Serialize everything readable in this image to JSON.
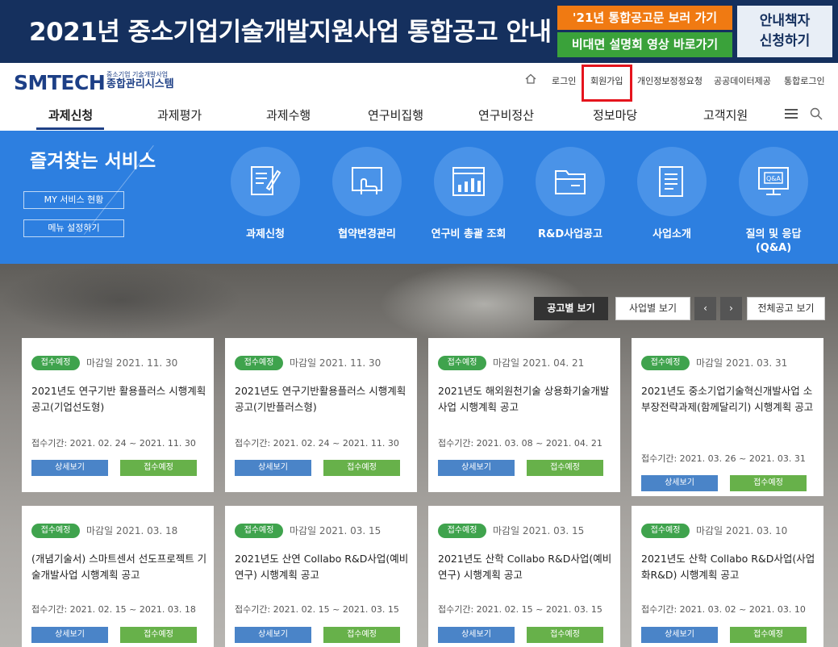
{
  "banner": {
    "title": "2021년 중소기업기술개발지원사업 통합공고 안내",
    "button_notice": "'21년 통합공고문 보러 가기",
    "button_video": "비대면 설명회 영상 바로가기",
    "button_guide_line1": "안내책자",
    "button_guide_line2": "신청하기"
  },
  "header": {
    "logo": "SMTECH",
    "logo_sub1": "중소기업 기술개발사업",
    "logo_sub2": "종합관리시스템",
    "util_links": [
      "로그인",
      "회원가입",
      "개인정보정정요청",
      "공공데이터제공",
      "통합로그인"
    ]
  },
  "gnb": {
    "items": [
      "과제신청",
      "과제평가",
      "과제수행",
      "연구비집행",
      "연구비정산",
      "정보마당",
      "고객지원"
    ]
  },
  "quick": {
    "title": "즐겨찾는 서비스",
    "my_service": "MY 서비스 현황",
    "menu_setting": "메뉴 설정하기",
    "services": [
      {
        "label": "과제신청",
        "icon": "document-edit-icon"
      },
      {
        "label": "협약변경관리",
        "icon": "hand-touch-icon"
      },
      {
        "label": "연구비 총괄 조회",
        "icon": "bar-chart-icon"
      },
      {
        "label": "R&D사업공고",
        "icon": "folder-icon"
      },
      {
        "label": "사업소개",
        "icon": "document-list-icon"
      },
      {
        "label": "질의 및 응답\n(Q&A)",
        "icon": "qa-monitor-icon"
      }
    ]
  },
  "notices": {
    "tab_by_notice": "공고별 보기",
    "tab_by_business": "사업별 보기",
    "prev": "‹",
    "next": "›",
    "view_all": "전체공고 보기",
    "cards": [
      {
        "badge": "접수예정",
        "deadline": "마감일 2021. 11. 30",
        "title": "2021년도 연구기반 활용플러스 시행계획 공고(기업선도형)",
        "period": "접수기간: 2021. 02. 24 ~ 2021. 11. 30",
        "detail": "상세보기",
        "status": "접수예정"
      },
      {
        "badge": "접수예정",
        "deadline": "마감일 2021. 11. 30",
        "title": "2021년도 연구기반활용플러스 시행계획 공고(기반플러스형)",
        "period": "접수기간: 2021. 02. 24 ~ 2021. 11. 30",
        "detail": "상세보기",
        "status": "접수예정"
      },
      {
        "badge": "접수예정",
        "deadline": "마감일 2021. 04. 21",
        "title": "2021년도 해외원천기술 상용화기술개발사업 시행계획 공고",
        "period": "접수기간: 2021. 03. 08 ~ 2021. 04. 21",
        "detail": "상세보기",
        "status": "접수예정"
      },
      {
        "badge": "접수예정",
        "deadline": "마감일 2021. 03. 31",
        "title": "2021년도 중소기업기술혁신개발사업 소부장전략과제(함께달리기) 시행계획 공고",
        "period": "접수기간: 2021. 03. 26 ~ 2021. 03. 31",
        "detail": "상세보기",
        "status": "접수예정"
      },
      {
        "badge": "접수예정",
        "deadline": "마감일 2021. 03. 18",
        "title": "(개념기술서) 스마트센서 선도프로젝트 기술개발사업 시행계획 공고",
        "period": "접수기간: 2021. 02. 15 ~ 2021. 03. 18",
        "detail": "상세보기",
        "status": "접수예정"
      },
      {
        "badge": "접수예정",
        "deadline": "마감일 2021. 03. 15",
        "title": "2021년도 산연 Collabo R&D사업(예비연구) 시행계획 공고",
        "period": "접수기간: 2021. 02. 15 ~ 2021. 03. 15",
        "detail": "상세보기",
        "status": "접수예정"
      },
      {
        "badge": "접수예정",
        "deadline": "마감일 2021. 03. 15",
        "title": "2021년도 산학 Collabo R&D사업(예비연구) 시행계획 공고",
        "period": "접수기간: 2021. 02. 15 ~ 2021. 03. 15",
        "detail": "상세보기",
        "status": "접수예정"
      },
      {
        "badge": "접수예정",
        "deadline": "마감일 2021. 03. 10",
        "title": "2021년도 산학 Collabo R&D사업(사업화R&D) 시행계획 공고",
        "period": "접수기간: 2021. 03. 02 ~ 2021. 03. 10",
        "detail": "상세보기",
        "status": "접수예정"
      }
    ]
  },
  "colors": {
    "banner_bg": "#15305e",
    "orange": "#f07a12",
    "green": "#3aa23a",
    "quick_bg": "#2d7fe0",
    "highlight": "#e5141d",
    "badge_green": "#3fa34d",
    "detail_blue": "#4a84c8"
  }
}
